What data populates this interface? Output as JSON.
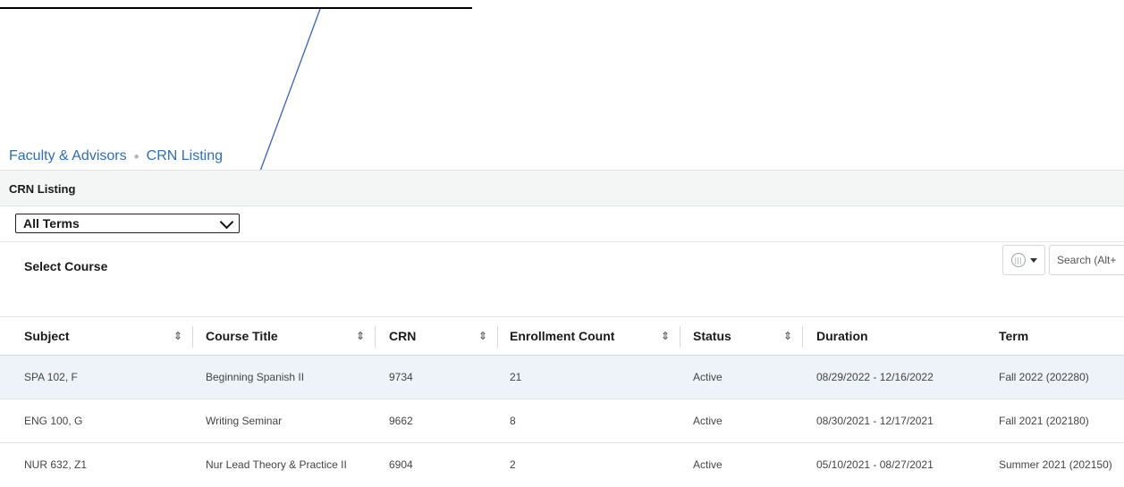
{
  "breadcrumb": {
    "parent": "Faculty & Advisors",
    "current": "CRN Listing"
  },
  "panel": {
    "title": "CRN Listing"
  },
  "term_filter": {
    "selected": "All Terms"
  },
  "course_section": {
    "title": "Select Course",
    "search_placeholder": "Search (Alt+"
  },
  "table": {
    "headers": {
      "subject": "Subject",
      "course_title": "Course Title",
      "crn": "CRN",
      "enrollment": "Enrollment Count",
      "status": "Status",
      "duration": "Duration",
      "term": "Term"
    },
    "rows": [
      {
        "subject": "SPA 102, F",
        "course_title": "Beginning Spanish II",
        "crn": "9734",
        "enrollment": "21",
        "status": "Active",
        "duration": "08/29/2022 - 12/16/2022",
        "term": "Fall 2022 (202280)"
      },
      {
        "subject": "ENG 100, G",
        "course_title": "Writing Seminar",
        "crn": "9662",
        "enrollment": "8",
        "status": "Active",
        "duration": "08/30/2021 - 12/17/2021",
        "term": "Fall 2021 (202180)"
      },
      {
        "subject": "NUR 632, Z1",
        "course_title": "Nur Lead Theory & Practice II",
        "crn": "6904",
        "enrollment": "2",
        "status": "Active",
        "duration": "05/10/2021 - 08/27/2021",
        "term": "Summer 2021 (202150)"
      }
    ]
  },
  "colors": {
    "link": "#2f6db5",
    "header_bg": "#f4f5f5",
    "selected_row": "#edf3f8",
    "annotation_arrow": "#3b5ec9"
  }
}
